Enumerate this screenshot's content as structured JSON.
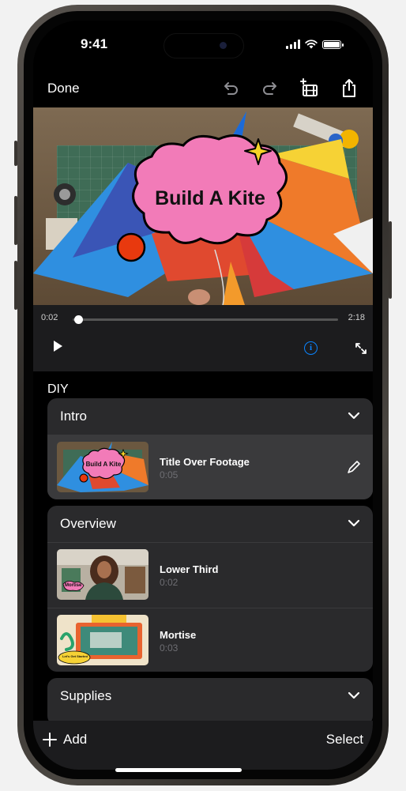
{
  "status": {
    "time": "9:41"
  },
  "nav": {
    "done_label": "Done",
    "icons": [
      "undo-icon",
      "redo-icon",
      "add-clip-icon",
      "share-icon"
    ]
  },
  "video": {
    "overlay_title": "Build A Kite"
  },
  "playback": {
    "current_time": "0:02",
    "total_time": "2:18",
    "progress": 0.015
  },
  "project": {
    "title": "DIY"
  },
  "sections": [
    {
      "title": "Intro",
      "clips": [
        {
          "name": "Title Over Footage",
          "duration": "0:05",
          "thumb_label": "Build A Kite",
          "selected": true
        }
      ]
    },
    {
      "title": "Overview",
      "clips": [
        {
          "name": "Lower Third",
          "duration": "0:02",
          "thumb_label": "Mortise"
        },
        {
          "name": "Mortise",
          "duration": "0:03",
          "thumb_label": "Let's Get Started"
        }
      ]
    },
    {
      "title": "Supplies",
      "clips": []
    }
  ],
  "bottom_bar": {
    "add_label": "Add",
    "select_label": "Select"
  },
  "colors": {
    "accent": "#0a84ff",
    "bubble_pink": "#f27bb8",
    "star_yellow": "#f5d327",
    "dot_red": "#e8390e"
  }
}
